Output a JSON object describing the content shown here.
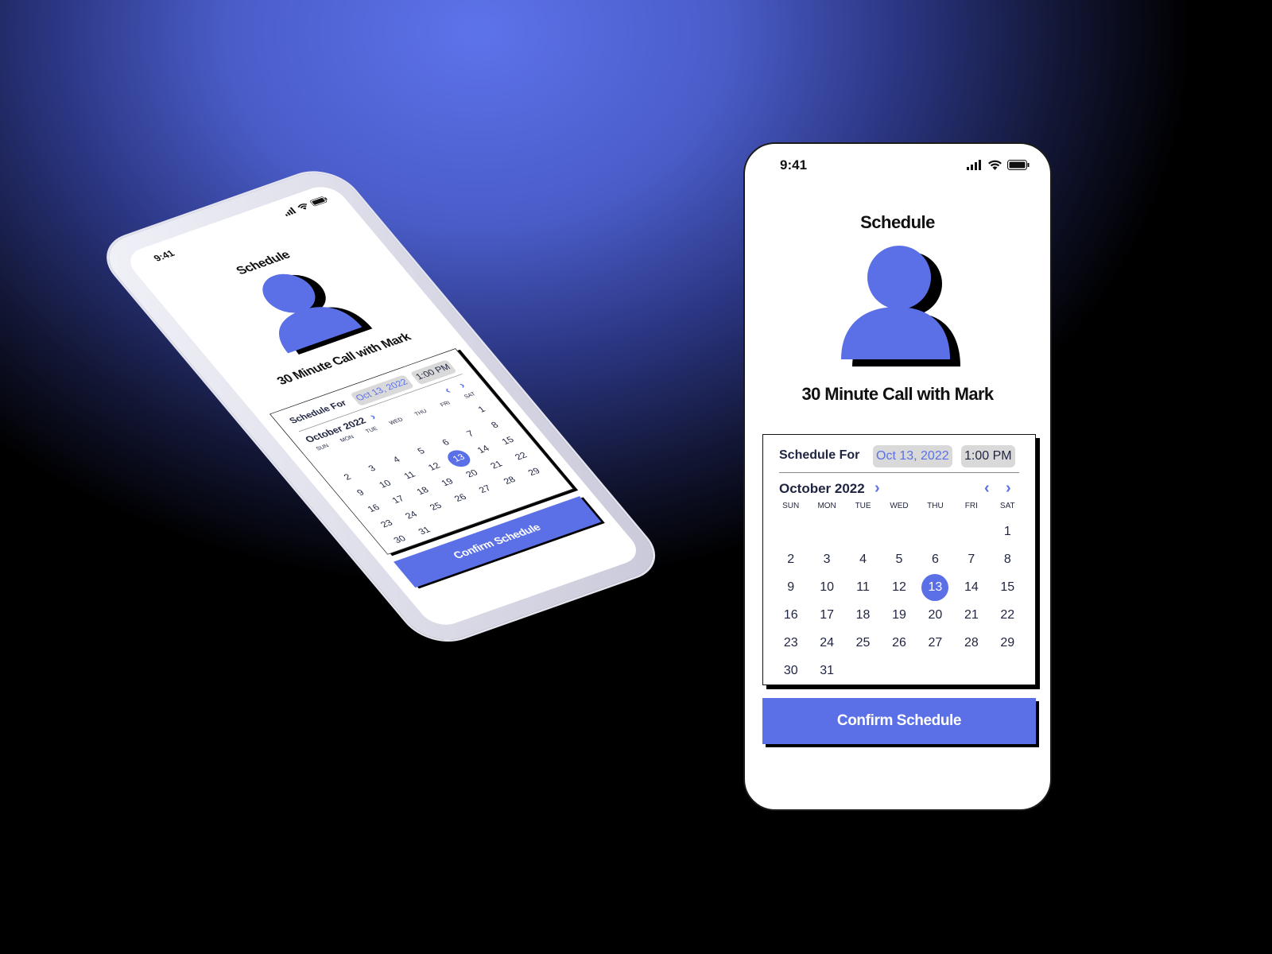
{
  "status": {
    "time": "9:41",
    "icons": [
      "signal-icon",
      "wifi-icon",
      "battery-icon"
    ]
  },
  "title": "Schedule",
  "subtitle": "30 Minute Call with Mark",
  "schedule": {
    "label": "Schedule For",
    "date": "Oct 13, 2022",
    "time": "1:00 PM"
  },
  "calendar": {
    "month": "October 2022",
    "weekdays": [
      "SUN",
      "MON",
      "TUE",
      "WED",
      "THU",
      "FRI",
      "SAT"
    ],
    "days": [
      "",
      "",
      "",
      "",
      "",
      "",
      "1",
      "2",
      "3",
      "4",
      "5",
      "6",
      "7",
      "8",
      "9",
      "10",
      "11",
      "12",
      "13",
      "14",
      "15",
      "16",
      "17",
      "18",
      "19",
      "20",
      "21",
      "22",
      "23",
      "24",
      "25",
      "26",
      "27",
      "28",
      "29",
      "30",
      "31"
    ],
    "selected": "13"
  },
  "confirm_label": "Confirm Schedule",
  "colors": {
    "accent": "#5b70e6",
    "shadow": "#000000",
    "pill": "#d9d9d9"
  }
}
